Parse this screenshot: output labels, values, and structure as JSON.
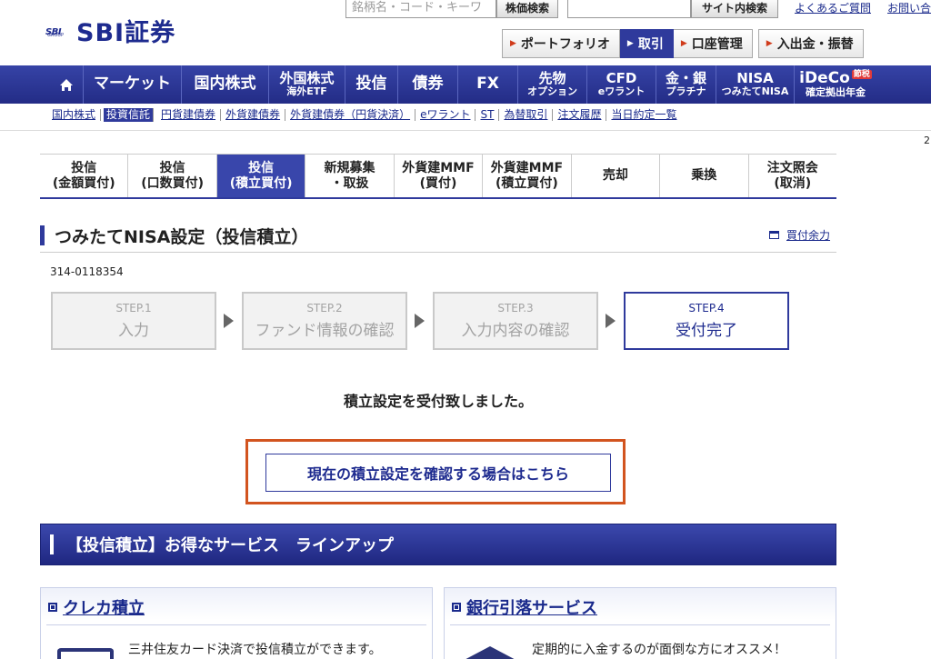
{
  "header": {
    "logo_mark": "SBI",
    "logo_group": "GROUP",
    "logo_text": "SBI証券",
    "search_placeholder": "銘柄名・コード・キーワ",
    "search_button": "株価検索",
    "site_search_button": "サイト内検索",
    "faq_link": "よくあるご質問",
    "contact_link": "お問い合"
  },
  "subnav": [
    {
      "label": "ポートフォリオ",
      "active": false
    },
    {
      "label": "取引",
      "active": true
    },
    {
      "label": "口座管理",
      "active": false
    },
    {
      "label": "入出金・振替",
      "active": false
    }
  ],
  "mainnav": {
    "home_icon": "home-icon",
    "items": [
      {
        "l1": "マーケット",
        "l2": ""
      },
      {
        "l1": "国内株式",
        "l2": ""
      },
      {
        "l1": "外国株式",
        "l2": "海外ETF"
      },
      {
        "l1": "投信",
        "l2": ""
      },
      {
        "l1": "債券",
        "l2": ""
      },
      {
        "l1": "FX",
        "l2": ""
      },
      {
        "l1": "先物",
        "l2": "オプション"
      },
      {
        "l1": "CFD",
        "l2": "eワラント"
      },
      {
        "l1": "金・銀",
        "l2": "プラチナ"
      },
      {
        "l1": "NISA",
        "l2": "つみたてNISA"
      },
      {
        "l1": "iDeCo",
        "l2": "確定拠出年金",
        "badge": "節税"
      }
    ]
  },
  "sublinks": [
    {
      "label": "国内株式",
      "active": false
    },
    {
      "label": "投資信託",
      "active": true
    },
    {
      "label": "円貨建債券",
      "active": false
    },
    {
      "label": "外貨建債券",
      "active": false
    },
    {
      "label": "外貨建債券（円貨決済）",
      "active": false
    },
    {
      "label": "eワラント",
      "active": false
    },
    {
      "label": "ST",
      "active": false
    },
    {
      "label": "為替取引",
      "active": false
    },
    {
      "label": "注文履歴",
      "active": false
    },
    {
      "label": "当日約定一覧",
      "active": false
    }
  ],
  "edge_digit": "2",
  "function_tabs": [
    {
      "l1": "投信",
      "l2": "(金額買付)",
      "active": false
    },
    {
      "l1": "投信",
      "l2": "(口数買付)",
      "active": false
    },
    {
      "l1": "投信",
      "l2": "(積立買付)",
      "active": true
    },
    {
      "l1": "新規募集",
      "l2": "・取扱",
      "active": false
    },
    {
      "l1": "外貨建MMF",
      "l2": "(買付)",
      "active": false
    },
    {
      "l1": "外貨建MMF",
      "l2": "(積立買付)",
      "active": false
    },
    {
      "l1": "売却",
      "l2": "",
      "active": false
    },
    {
      "l1": "乗換",
      "l2": "",
      "active": false
    },
    {
      "l1": "注文照会",
      "l2": "(取消)",
      "active": false
    }
  ],
  "page": {
    "title": "つみたてNISA設定（投信積立）",
    "buy_power_link": "買付余力",
    "account_number": "314-0118354"
  },
  "steps": [
    {
      "num": "STEP.1",
      "label": "入力",
      "active": false
    },
    {
      "num": "STEP.2",
      "label": "ファンド情報の確認",
      "active": false
    },
    {
      "num": "STEP.3",
      "label": "入力内容の確認",
      "active": false
    },
    {
      "num": "STEP.4",
      "label": "受付完了",
      "active": true
    }
  ],
  "completion_message": "積立設定を受付致しました。",
  "confirm_button": "現在の積立設定を確認する場合はこちら",
  "lineup_title": "【投信積立】お得なサービス　ラインアップ",
  "services": [
    {
      "title": "クレカ積立",
      "desc": "三井住友カード決済で投信積立ができます。",
      "icon": "credit-card-icon"
    },
    {
      "title": "銀行引落サービス",
      "desc": "定期的に入金するのが面倒な方にオススメ！",
      "icon": "bank-icon"
    }
  ],
  "colors": {
    "brand_blue": "#2f3a9c",
    "highlight_orange": "#d2541f",
    "step_inactive": "#f2f2f2"
  }
}
